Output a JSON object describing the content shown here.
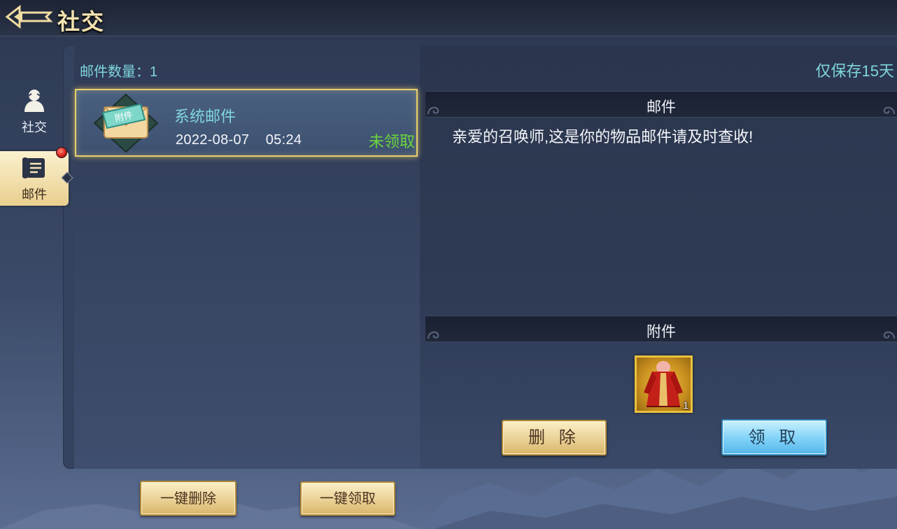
{
  "header": {
    "title": "社交"
  },
  "sidebar": {
    "items": [
      {
        "label": "社交"
      },
      {
        "label": "邮件"
      }
    ]
  },
  "mail_list": {
    "count_label": "邮件数量：1",
    "items": [
      {
        "subject": "系统邮件",
        "icon_text": "附件",
        "date": "2022-08-07",
        "time": "05:24",
        "status": "未领取"
      }
    ]
  },
  "detail": {
    "keep_notice": "仅保存15天",
    "mail_section_title": "邮件",
    "body": "亲爱的召唤师,这是你的物品邮件请及时查收!",
    "attachment_section_title": "附件",
    "attachments": [
      {
        "count": "1"
      }
    ]
  },
  "buttons": {
    "delete": "删 除",
    "claim": "领 取",
    "delete_all": "一键删除",
    "claim_all": "一键领取"
  },
  "colors": {
    "accent_cyan": "#7fd6dc",
    "status_green": "#6bd53c",
    "highlight_gold": "#e8cf6a"
  }
}
